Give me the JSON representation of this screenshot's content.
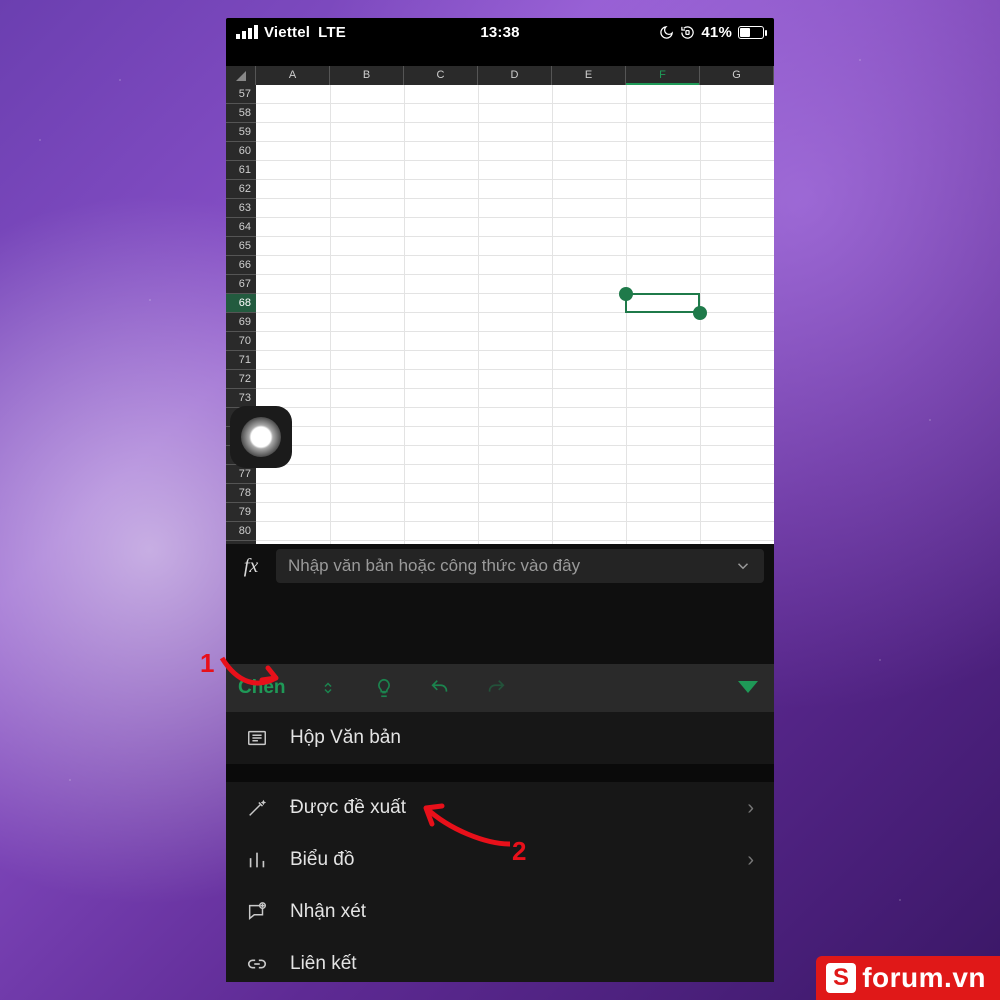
{
  "status_bar": {
    "carrier": "Viettel",
    "network": "LTE",
    "time": "13:38",
    "battery_pct": "41%"
  },
  "columns": [
    "A",
    "B",
    "C",
    "D",
    "E",
    "F",
    "G"
  ],
  "row_start": 57,
  "row_end": 80,
  "selected_col_index": 5,
  "selected_row": 68,
  "formula_bar": {
    "label": "fx",
    "placeholder": "Nhập văn bản hoặc công thức vào đây"
  },
  "ribbon": {
    "active_tab": "Chèn"
  },
  "menu": {
    "textbox": "Hộp Văn bản",
    "recommended": "Được đề xuất",
    "chart": "Biểu đồ",
    "comment": "Nhận xét",
    "link": "Liên kết"
  },
  "annotations": {
    "one": "1",
    "two": "2"
  },
  "watermark": {
    "text": "forum.vn",
    "badge": "S"
  }
}
